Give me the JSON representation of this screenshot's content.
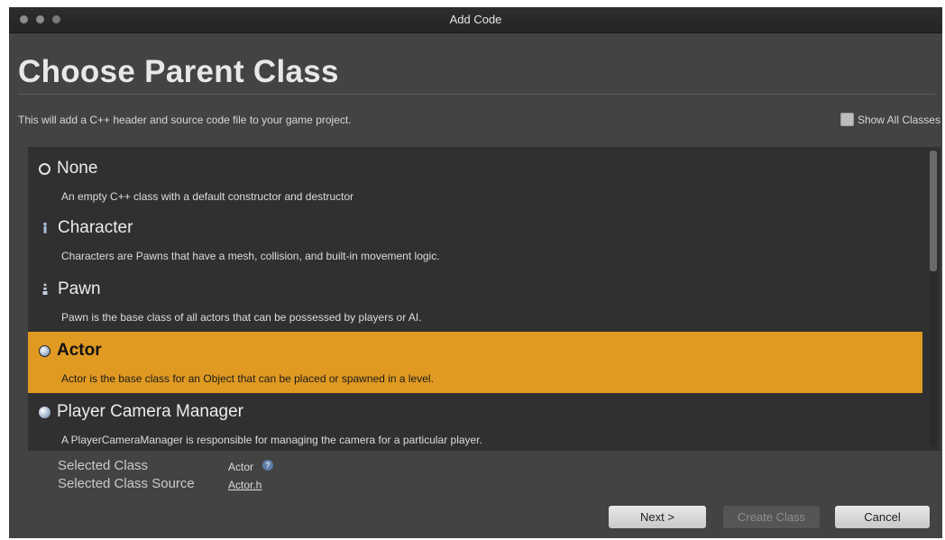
{
  "window": {
    "title": "Add Code"
  },
  "header": {
    "title": "Choose Parent Class",
    "subtitle": "This will add a C++ header and source code file to your game project.",
    "show_all_label": "Show All Classes"
  },
  "classes": [
    {
      "name": "None",
      "description": "An empty C++ class with a default constructor and destructor",
      "icon": "circle-outline-icon"
    },
    {
      "name": "Character",
      "description": "Characters are Pawns that have a mesh, collision, and built-in movement logic.",
      "icon": "character-icon"
    },
    {
      "name": "Pawn",
      "description": "Pawn is the base class of all actors that can be possessed by players or AI.",
      "icon": "pawn-icon"
    },
    {
      "name": "Actor",
      "description": "Actor is the base class for an Object that can be placed or spawned in a level.",
      "icon": "actor-sphere-icon",
      "selected": true
    },
    {
      "name": "Player Camera Manager",
      "description": "A PlayerCameraManager is responsible for managing the camera for a particular player.",
      "icon": "sphere-icon"
    }
  ],
  "selection": {
    "class_label": "Selected Class",
    "class_value": "Actor",
    "source_label": "Selected Class Source",
    "source_value": "Actor.h"
  },
  "buttons": {
    "next": "Next >",
    "create": "Create Class",
    "cancel": "Cancel"
  },
  "colors": {
    "selected_row": "#e09a22",
    "panel": "#303030",
    "window": "#434343"
  }
}
